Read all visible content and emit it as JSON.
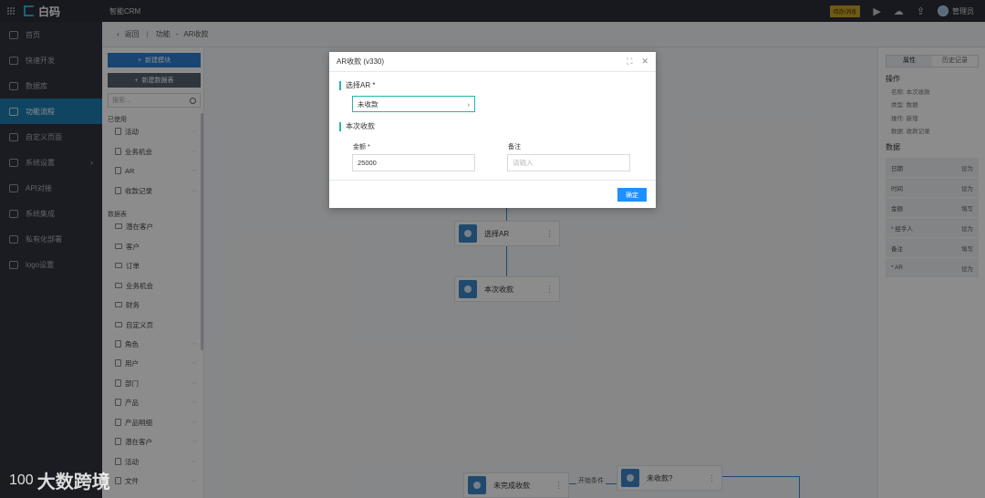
{
  "topbar": {
    "brand": "白码",
    "app_name": "智能CRM",
    "badge": "待办/消息",
    "user": "管理员"
  },
  "sidebar": {
    "items": [
      {
        "label": "首页"
      },
      {
        "label": "快速开发"
      },
      {
        "label": "数据库"
      },
      {
        "label": "功能流程"
      },
      {
        "label": "自定义页面"
      },
      {
        "label": "系统设置"
      },
      {
        "label": "API对接"
      },
      {
        "label": "系统集成"
      },
      {
        "label": "私有化部署"
      },
      {
        "label": "logo设置"
      }
    ]
  },
  "header": {
    "back": "返回",
    "crumb_parent": "功能",
    "crumb_current": "AR收款"
  },
  "modules": {
    "new_module": "新建模块",
    "new_table": "新建数据表",
    "search_placeholder": "搜索...",
    "group_used": "已使用",
    "used_items": [
      "活动",
      "业务机会",
      "AR",
      "收款记录"
    ],
    "group_tables": "数据表",
    "table_items": [
      "潜在客户",
      "客户",
      "订单",
      "业务机会",
      "财务",
      "自定义页",
      "角色",
      "用户",
      "部门",
      "产品",
      "产品明细",
      "潜在客户",
      "活动",
      "文件"
    ]
  },
  "canvas": {
    "node1": "选择AR",
    "node2": "本次收款",
    "node3": "未完成收款",
    "node4": "未收款?",
    "link_label": "开始条件"
  },
  "props": {
    "tab_props": "属性",
    "tab_history": "历史记录",
    "section_op": "操作",
    "op_rows": [
      {
        "k": "名称",
        "v": "本次收款"
      },
      {
        "k": "类型",
        "v": "数据"
      },
      {
        "k": "操作",
        "v": "新增"
      },
      {
        "k": "数据",
        "v": "收款记录"
      }
    ],
    "section_data": "数据",
    "data_rows": [
      {
        "k": "日期",
        "v": "设为"
      },
      {
        "k": "时间",
        "v": "设为"
      },
      {
        "k": "金额",
        "v": "填写"
      },
      {
        "k": "* 经手人",
        "v": "设为"
      },
      {
        "k": "备注",
        "v": "填写"
      },
      {
        "k": "* AR",
        "v": "设为"
      }
    ]
  },
  "modal": {
    "title": "AR收款 (v330)",
    "section_select": "选择AR *",
    "picker_value": "未收款",
    "section_current": "本次收款",
    "amount_label": "金额 *",
    "amount_value": "25000",
    "remark_label": "备注",
    "remark_placeholder": "请输入",
    "ok": "确定"
  },
  "watermark": {
    "mark": "100",
    "text": "大数跨境"
  }
}
